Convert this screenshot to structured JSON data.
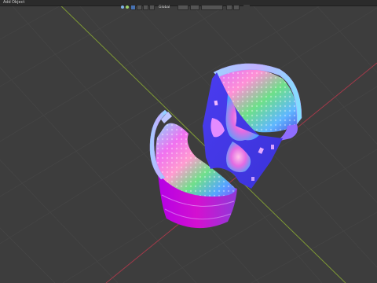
{
  "menubar": {
    "items": [
      {
        "label": "Add"
      },
      {
        "label": "Object"
      }
    ]
  },
  "header": {
    "orientation_label": "Global",
    "icons": [
      "viewport-shading-icon",
      "overlay-icon",
      "solid-icon",
      "material-icon",
      "rendered-icon",
      "gizmo-icon",
      "filter-icon"
    ]
  },
  "colors": {
    "background": "#3d3d3d",
    "grid": "#464646",
    "axis_x": "#a33a4a",
    "axis_y": "#7f9a35",
    "active_button": "#4772b3"
  },
  "model": {
    "shading": "normal-map"
  }
}
